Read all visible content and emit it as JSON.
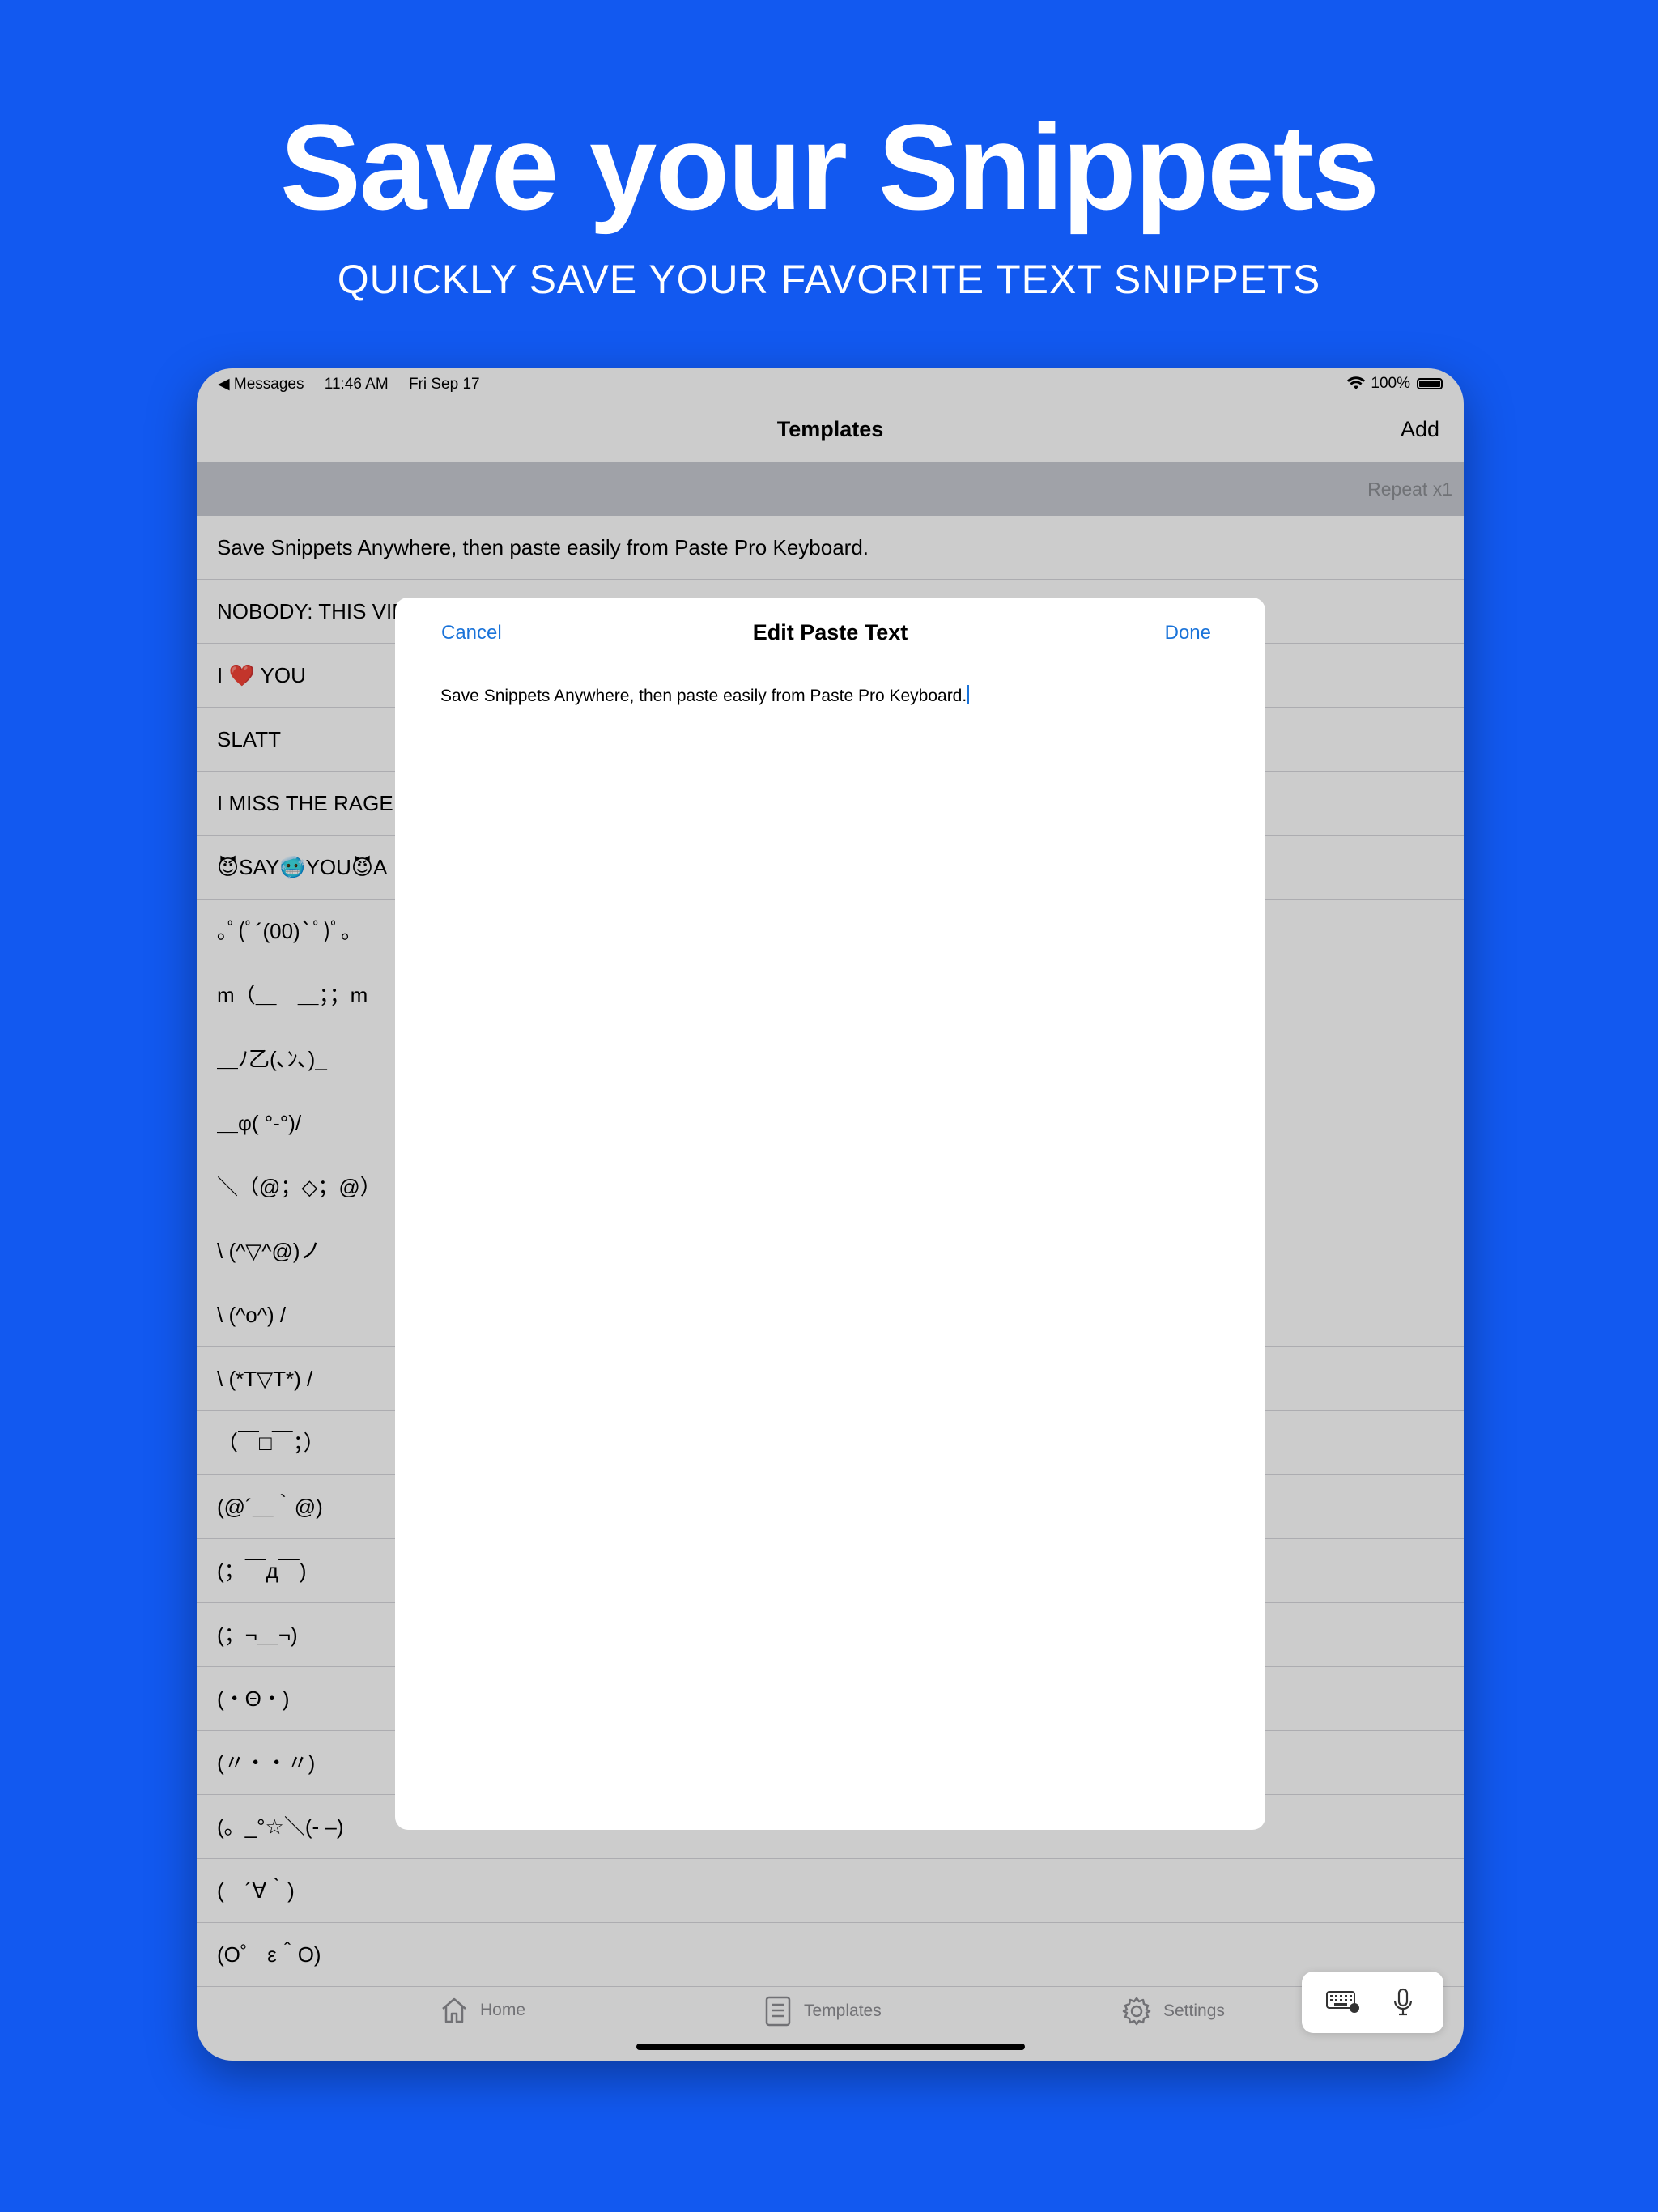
{
  "promo": {
    "headline": "Save your Snippets",
    "subheadline": "QUICKLY SAVE YOUR FAVORITE TEXT SNIPPETS"
  },
  "status_bar": {
    "back_app": "◀ Messages",
    "time": "11:46 AM",
    "date": "Fri Sep 17",
    "battery": "100%"
  },
  "nav": {
    "title": "Templates",
    "add_label": "Add"
  },
  "repeat_label": "Repeat x1",
  "templates": [
    "Save Snippets Anywhere, then paste easily from Paste Pro Keyboard.",
    "NOBODY: THIS VID",
    "I ❤️ YOU",
    "SLATT",
    "I MISS THE RAGE❗",
    "😈SAY🥶YOU😈A",
    "｡ﾟ(ﾟ´(00)`ﾟ)ﾟ｡",
    "m（＿　＿；；m",
    "＿ﾉ乙(､ﾝ､)_",
    "＿φ( °-°)/",
    "＼（@；◇；@）",
    "\\ (^▽^@)ノ",
    "\\ (^o^) /",
    "\\ (*T▽T*) /",
    "（￣□￣；）",
    "(@´＿｀@)",
    "(；￣д￣)",
    "(；¬＿¬)",
    "(・Θ・)",
    "(〃・・〃)",
    "(。_°☆＼(- –)",
    "(　´∀｀)",
    "(O゜ ε＾O)"
  ],
  "modal": {
    "cancel_label": "Cancel",
    "title": "Edit Paste Text",
    "done_label": "Done",
    "text": "Save Snippets Anywhere, then paste easily from Paste Pro Keyboard."
  },
  "tabs": [
    {
      "label": "Home",
      "icon": "house-icon"
    },
    {
      "label": "Templates",
      "icon": "document-list-icon"
    },
    {
      "label": "Settings",
      "icon": "gear-icon"
    }
  ],
  "colors": {
    "background": "#1259f0",
    "accent": "#1a73d9"
  }
}
